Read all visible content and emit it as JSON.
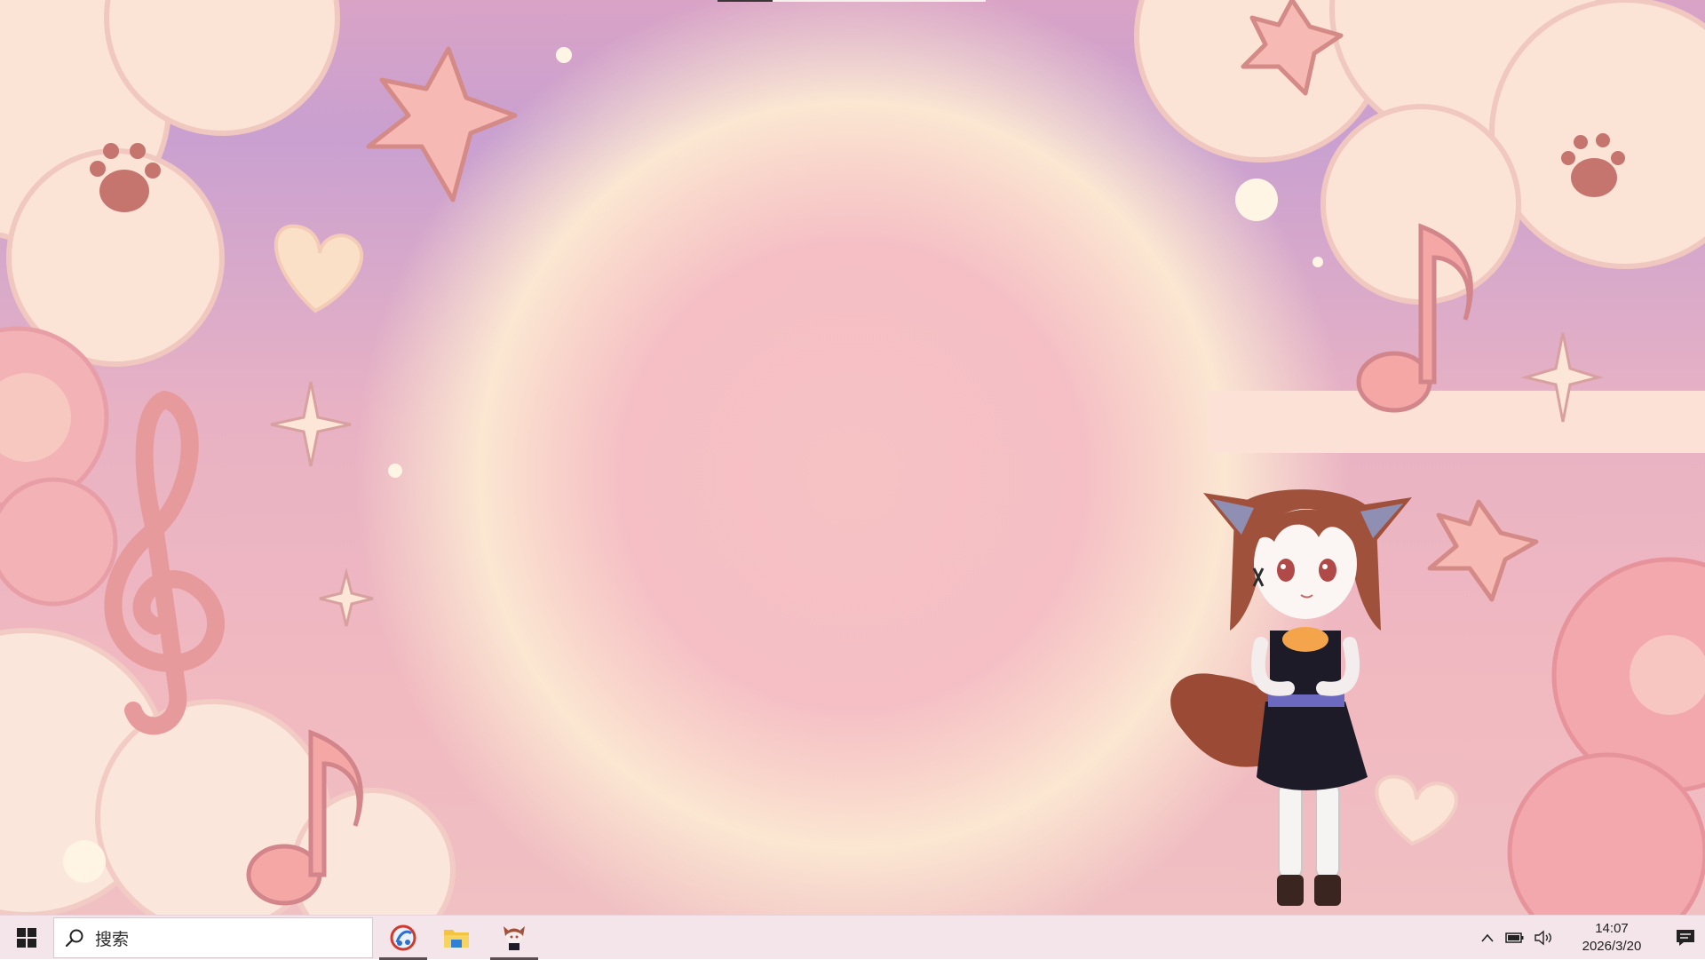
{
  "taskbar": {
    "search_placeholder": "搜索",
    "apps": [
      {
        "name": "browser",
        "icon": "browser-app-icon",
        "active": true
      },
      {
        "name": "file-explorer",
        "icon": "folder-icon",
        "active": false
      },
      {
        "name": "desktop-mascot",
        "icon": "fox-girl-app-icon",
        "active": true
      }
    ],
    "tray": {
      "expand_icon": "chevron-up-icon",
      "battery_icon": "battery-icon",
      "volume_icon": "speaker-icon",
      "time": "14:07",
      "date": "2026/3/20",
      "notifications_icon": "notification-icon"
    }
  },
  "colors": {
    "taskbar_bg": "#f3e5e9",
    "active_indicator": "#5a4e52",
    "wallpaper_pink": "#f5bfc5",
    "wallpaper_lilac": "#c9a0d0"
  }
}
